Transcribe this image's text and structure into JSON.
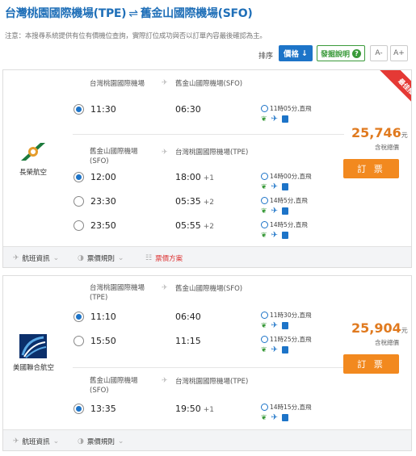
{
  "header": {
    "from": "台灣桃園國際機場(TPE)",
    "arrow": "⇌",
    "to": "舊金山國際機場(SFO)",
    "notice": "注意：本搜尋系統提供有位有價機位查詢，實際訂位成功與否以訂單內容最後確認為主。"
  },
  "toolbar": {
    "sort_label": "排序",
    "price_label": "價格",
    "price_arrow": "↓",
    "rec_label": "發掘說明",
    "rec_icon": "?",
    "font_small": "A-",
    "font_large": "A+"
  },
  "cards": [
    {
      "badge": "最佳推薦",
      "airline": "長榮航空",
      "price": "25,746",
      "price_unit": "元",
      "tax": "含稅總價",
      "book": "訂 票",
      "outbound": {
        "from": "台灣桃園國際機場",
        "to": "舊金山國際機場(SFO)",
        "rows": [
          {
            "dep": "11:30",
            "arr": "06:30",
            "plus": "",
            "duration": "11時05分,直飛",
            "selected": true
          }
        ]
      },
      "inbound": {
        "from": "舊金山國際機場\n(SFO)",
        "to": "台灣桃園國際機場(TPE)",
        "rows": [
          {
            "dep": "12:00",
            "arr": "18:00",
            "plus": "+1",
            "duration": "14時00分,直飛",
            "selected": true
          },
          {
            "dep": "23:30",
            "arr": "05:35",
            "plus": "+2",
            "duration": "14時5分,直飛",
            "selected": false
          },
          {
            "dep": "23:50",
            "arr": "05:55",
            "plus": "+2",
            "duration": "14時5分,直飛",
            "selected": false
          }
        ]
      },
      "footer": {
        "info": "航班資訊",
        "rules": "票價規則",
        "plan": "票價方案"
      }
    },
    {
      "airline": "美國聯合航空",
      "price": "25,904",
      "price_unit": "元",
      "tax": "含稅總價",
      "book": "訂 票",
      "outbound": {
        "from": "台灣桃園國際機場\n(TPE)",
        "to": "舊金山國際機場(SFO)",
        "rows": [
          {
            "dep": "11:10",
            "arr": "06:40",
            "plus": "",
            "duration": "11時30分,直飛",
            "selected": true
          },
          {
            "dep": "15:50",
            "arr": "11:15",
            "plus": "",
            "duration": "11時25分,直飛",
            "selected": false
          }
        ]
      },
      "inbound": {
        "from": "舊金山國際機場\n(SFO)",
        "to": "台灣桃園國際機場(TPE)",
        "rows": [
          {
            "dep": "13:35",
            "arr": "19:50",
            "plus": "+1",
            "duration": "14時15分,直飛",
            "selected": true
          }
        ]
      },
      "footer": {
        "info": "航班資訊",
        "rules": "票價規則"
      }
    }
  ]
}
